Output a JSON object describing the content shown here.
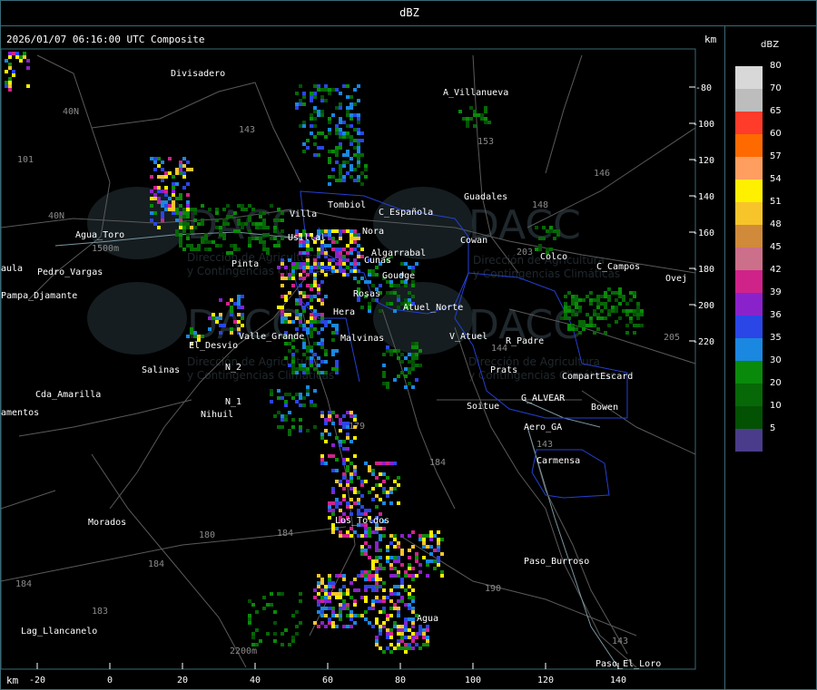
{
  "header": {
    "title": "dBZ"
  },
  "map": {
    "timestamp": "2026/01/07 06:16:00 UTC Composite",
    "unit_top": "km",
    "unit_bottom": "km",
    "y_ticks": [
      "-80",
      "-100",
      "-120",
      "-140",
      "-160",
      "-180",
      "-200",
      "-220"
    ],
    "x_ticks": [
      "-20",
      "0",
      "20",
      "40",
      "60",
      "80",
      "100",
      "120",
      "140"
    ],
    "places": [
      "Divisadero",
      "A_Villanueva",
      "Guadales",
      "Agua_Toro",
      "C_Española",
      "Nora",
      "Algarrabal",
      "Villa",
      "Pinta",
      "Cunas",
      "Goudge",
      "Rosas",
      "Atuel_Norte",
      "V_Atuel",
      "R_Padre",
      "Prats",
      "CompartEscard",
      "G_ALVEAR",
      "Bowen",
      "Soitue",
      "Aero_GA",
      "Carmensa",
      "Paso_Burroso",
      "Paso_El_Loro",
      "Valle_Grande",
      "Malvinas",
      "El_Desvio",
      "Salinas",
      "N_2",
      "N_1",
      "Nihuil",
      "Cda_Amarilla",
      "amentos",
      "Morados",
      "Lag_Llancanelo",
      "Pampa_Djamante",
      "aula",
      "Los_Toldos",
      "Agua",
      "C_Campos",
      "Ovej",
      "Colco",
      "Cowan",
      "Hera",
      "Tombiol",
      "Usillal",
      "Pedro_Vargas"
    ],
    "routes": [
      "40N",
      "40N",
      "101",
      "143",
      "153",
      "146",
      "148",
      "203",
      "143",
      "184",
      "184",
      "180",
      "184",
      "183",
      "184",
      "190",
      "143",
      "205",
      "179",
      "144"
    ],
    "watermark": {
      "brand": "DACC",
      "line1": "Dirección de Agricultura",
      "line2": "y Contingencias Climáticas"
    },
    "elevations": [
      "1500m",
      "2200m"
    ]
  },
  "legend": {
    "title": "dBZ",
    "items": [
      {
        "label": "80",
        "color": "#d8d8d8"
      },
      {
        "label": "70",
        "color": "#bdbdbd"
      },
      {
        "label": "65",
        "color": "#ff3b2a"
      },
      {
        "label": "60",
        "color": "#ff6a00"
      },
      {
        "label": "57",
        "color": "#ff9e5e"
      },
      {
        "label": "54",
        "color": "#fff000"
      },
      {
        "label": "51",
        "color": "#f7c52a"
      },
      {
        "label": "48",
        "color": "#d08a3a"
      },
      {
        "label": "45",
        "color": "#cc6f8a"
      },
      {
        "label": "42",
        "color": "#d0238a"
      },
      {
        "label": "39",
        "color": "#8a22cc"
      },
      {
        "label": "36",
        "color": "#2a46e6"
      },
      {
        "label": "35",
        "color": "#1a87e0"
      },
      {
        "label": "30",
        "color": "#0a8a0a"
      },
      {
        "label": "20",
        "color": "#066806"
      },
      {
        "label": "10",
        "color": "#035103"
      },
      {
        "label": "5",
        "color": "#4a3c8a"
      }
    ]
  }
}
